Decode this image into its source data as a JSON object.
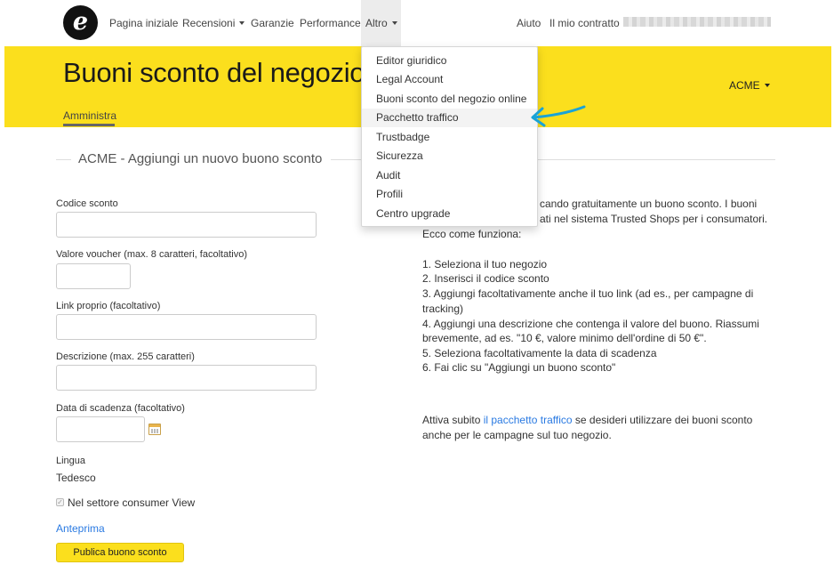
{
  "nav": {
    "items": [
      {
        "label": "Pagina iniziale"
      },
      {
        "label": "Recensioni"
      },
      {
        "label": "Garanzie"
      },
      {
        "label": "Performance"
      },
      {
        "label": "Altro"
      }
    ],
    "help": "Aiuto",
    "contract": "Il mio contratto"
  },
  "logo": {
    "letter": "e"
  },
  "header": {
    "title": "Buoni sconto del negozio",
    "shop_selector": "ACME",
    "tab": "Amministra"
  },
  "section": {
    "title": "ACME - Aggiungi un nuovo buono sconto"
  },
  "form": {
    "code_label": "Codice sconto",
    "code_value": "",
    "voucher_label": "Valore voucher (max. 8 caratteri, facoltativo)",
    "voucher_value": "",
    "link_label": "Link proprio (facoltativo)",
    "link_value": "",
    "desc_label": "Descrizione (max. 255 caratteri)",
    "desc_value": "",
    "expiry_label": "Data di scadenza (facoltativo)",
    "expiry_value": "",
    "language_label": "Lingua",
    "language_value": "Tedesco",
    "consumer_view_label": "Nel settore consumer View",
    "consumer_view_checked": true,
    "preview_link": "Anteprima",
    "publish_button": "Publica buono sconto"
  },
  "info": {
    "intro_line1": "cando gratuitamente un buono sconto. I buoni",
    "intro_line2": "ati nel sistema Trusted Shops per i consumatori.",
    "how_it_works": "Ecco come funziona:",
    "steps": [
      "1. Seleziona il tuo negozio",
      "2. Inserisci il codice sconto",
      "3. Aggiungi facoltativamente anche il tuo link (ad es., per campagne di",
      "tracking)",
      "4. Aggiungi una descrizione che contenga il valore del buono. Riassumi",
      "brevemente, ad es. \"10 €, valore minimo dell'ordine di 50 €\".",
      "5. Seleziona facoltativamente la data di scadenza",
      "6. Fai clic su \"Aggiungi un buono sconto\""
    ],
    "cta_prefix": "Attiva subito ",
    "cta_link": "il pacchetto traffico",
    "cta_suffix": " se desideri utilizzare dei buoni sconto",
    "cta_line2": "anche per le campagne sul tuo negozio."
  },
  "dropdown": {
    "items": [
      {
        "label": "Editor giuridico"
      },
      {
        "label": "Legal Account"
      },
      {
        "label": "Buoni sconto del negozio online"
      },
      {
        "label": "Pacchetto traffico"
      },
      {
        "label": "Trustbadge"
      },
      {
        "label": "Sicurezza"
      },
      {
        "label": "Audit"
      },
      {
        "label": "Profili"
      },
      {
        "label": "Centro upgrade"
      }
    ],
    "highlighted_index": 3
  },
  "colors": {
    "brand_yellow": "#fbdf1d",
    "link_blue": "#2a7ae2",
    "annotation_arrow": "#1aa3d6"
  },
  "icons": {
    "logo": "e-logo-icon",
    "calendar": "calendar-icon",
    "annotation": "arrow-annotation-icon"
  }
}
